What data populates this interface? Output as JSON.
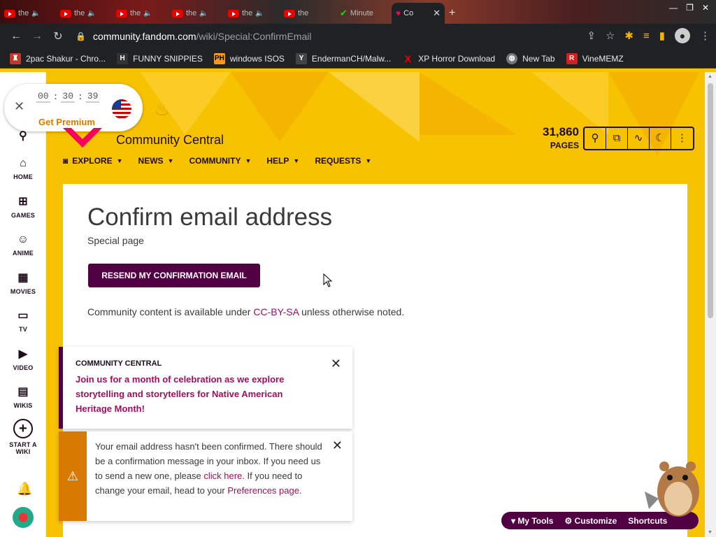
{
  "browser": {
    "tabs": [
      {
        "label": "the",
        "icon": "youtube-icon"
      },
      {
        "label": "the",
        "icon": "youtube-icon"
      },
      {
        "label": "the",
        "icon": "youtube-icon"
      },
      {
        "label": "the",
        "icon": "youtube-icon"
      },
      {
        "label": "the",
        "icon": "youtube-icon"
      },
      {
        "label": "the",
        "icon": "youtube-icon"
      },
      {
        "label": "Minute",
        "icon": "green-check-icon"
      },
      {
        "label": "Co",
        "icon": "fandom-icon",
        "active": true
      }
    ],
    "url_domain": "community.fandom.com",
    "url_path": "/wiki/Special:ConfirmEmail",
    "bookmarks": [
      {
        "label": "2pac Shakur - Chro...",
        "icon": "2pac-icon",
        "color": "#c0392b"
      },
      {
        "label": "FUNNY SNIPPIES",
        "icon": "H",
        "color": "#333"
      },
      {
        "label": "windows ISOS",
        "icon": "PH",
        "color": "#f7971d"
      },
      {
        "label": "EndermanCH/Malw...",
        "icon": "Y",
        "color": "#222"
      },
      {
        "label": "XP Horror Download",
        "icon": "X",
        "color": "#d00"
      },
      {
        "label": "New Tab",
        "icon": "globe-icon",
        "color": "#777"
      },
      {
        "label": "VineMEMZ",
        "icon": "R",
        "color": "#c22"
      }
    ]
  },
  "timer_widget": {
    "hours": "00",
    "minutes": "30",
    "seconds": "39",
    "premium_label": "Get Premium"
  },
  "rail": {
    "items": [
      {
        "label": "HOME",
        "icon": "home-icon"
      },
      {
        "label": "GAMES",
        "icon": "gamepad-icon"
      },
      {
        "label": "ANIME",
        "icon": "anime-icon"
      },
      {
        "label": "MOVIES",
        "icon": "movies-icon"
      },
      {
        "label": "TV",
        "icon": "tv-icon"
      },
      {
        "label": "VIDEO",
        "icon": "video-icon"
      },
      {
        "label": "WIKIS",
        "icon": "wikis-icon"
      }
    ],
    "start_wiki_line1": "START A",
    "start_wiki_line2": "WIKI"
  },
  "header": {
    "site_name": "Community Central",
    "pages_count": "31,860",
    "pages_label": "PAGES",
    "nav": [
      {
        "label": "EXPLORE"
      },
      {
        "label": "NEWS"
      },
      {
        "label": "COMMUNITY"
      },
      {
        "label": "HELP"
      },
      {
        "label": "REQUESTS"
      }
    ]
  },
  "main": {
    "title": "Confirm email address",
    "subtitle": "Special page",
    "resend_button": "RESEND MY CONFIRMATION EMAIL",
    "license_pre": "Community content is available under ",
    "license_link": "CC-BY-SA",
    "license_post": " unless otherwise noted."
  },
  "notice": {
    "header": "COMMUNITY CENTRAL",
    "body": "Join us for a month of celebration as we explore storytelling and storytellers for Native American Heritage Month!"
  },
  "warning": {
    "text1": "Your email address hasn't been confirmed. There should be a confirmation message in your inbox. If you need us to send a new one, please ",
    "link1": "click here",
    "text2": ". If you need to change your email, head to your ",
    "link2": "Preferences page",
    "text3": "."
  },
  "toolbar": {
    "my_tools": "My Tools",
    "customize": "Customize",
    "shortcuts": "Shortcuts"
  },
  "colors": {
    "accent": "#520044",
    "link": "#9d1060",
    "background": "#f7c200",
    "warning": "#d97a00"
  }
}
